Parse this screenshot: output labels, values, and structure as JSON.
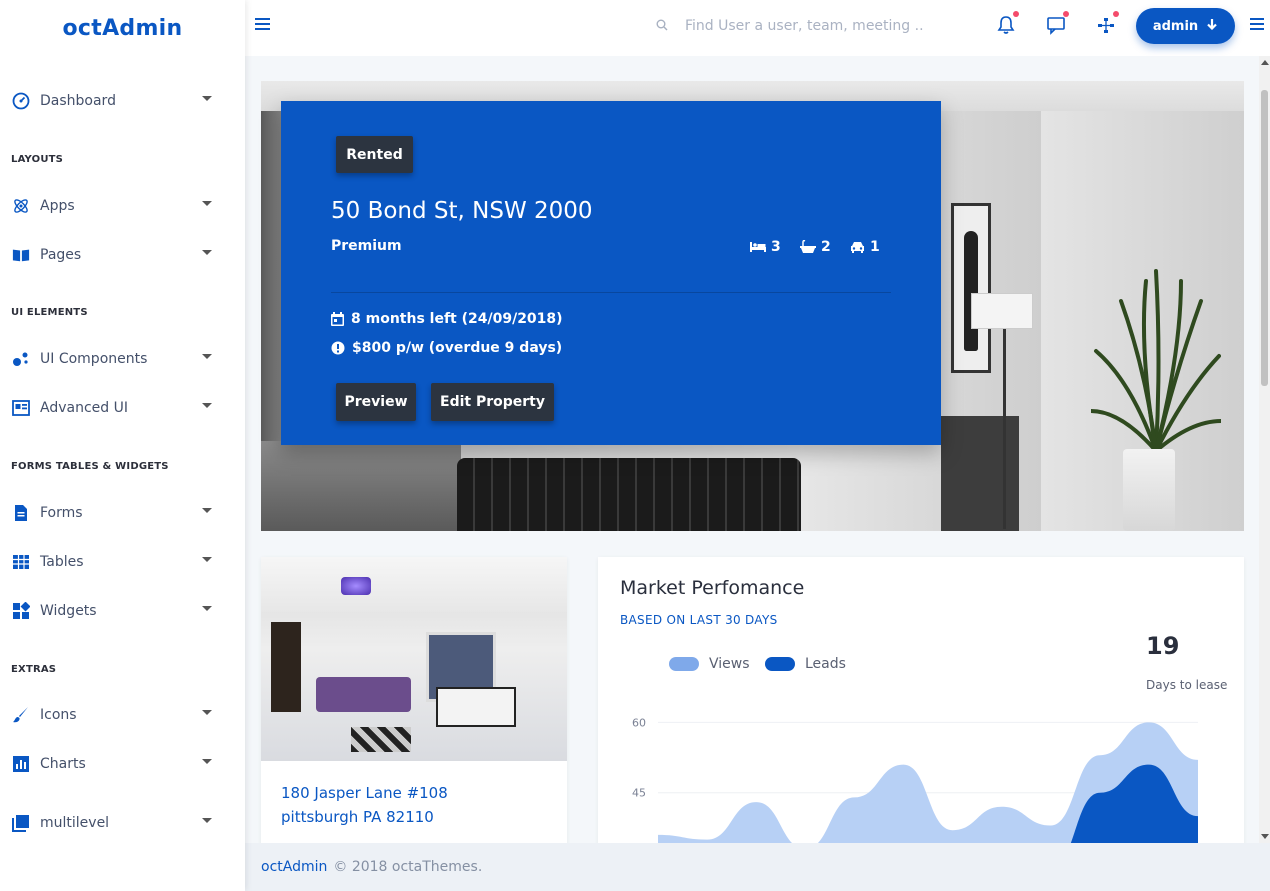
{
  "brand": "octAdmin",
  "sidebar": {
    "items": [
      {
        "label": "Dashboard",
        "icon": "dashboard-icon"
      },
      {
        "label": "Apps",
        "icon": "atom-icon"
      },
      {
        "label": "Pages",
        "icon": "book-icon"
      },
      {
        "label": "UI Components",
        "icon": "bubbles-icon"
      },
      {
        "label": "Advanced UI",
        "icon": "panel-icon"
      },
      {
        "label": "Forms",
        "icon": "document-icon"
      },
      {
        "label": "Tables",
        "icon": "table-icon"
      },
      {
        "label": "Widgets",
        "icon": "widgets-icon"
      },
      {
        "label": "Icons",
        "icon": "brush-icon"
      },
      {
        "label": "Charts",
        "icon": "bar-chart-icon"
      },
      {
        "label": "multilevel",
        "icon": "layers-icon"
      }
    ],
    "sections": [
      "LAYOUTS",
      "UI ELEMENTS",
      "FORMS TABLES & WIDGETS",
      "EXTRAS"
    ]
  },
  "topbar": {
    "search_placeholder": "Find User a user, team, meeting ..",
    "admin_label": "admin"
  },
  "hero": {
    "badge": "Rented",
    "address": "50 Bond St, NSW 2000",
    "tier": "Premium",
    "beds": "3",
    "baths": "2",
    "cars": "1",
    "lease_left": "8 months left (24/09/2018)",
    "rent": "$800 p/w (overdue 9 days)",
    "preview_label": "Preview",
    "edit_label": "Edit Property"
  },
  "property": {
    "address_line1": "180 Jasper Lane #108",
    "address_line2": "pittsburgh PA 82110"
  },
  "market": {
    "title": "Market Perfomance",
    "subtitle": "BASED ON LAST 30 DAYS",
    "stat_value": "19",
    "stat_label": "Days to lease"
  },
  "chart_data": {
    "type": "area",
    "series": [
      {
        "name": "Views",
        "color": "#b7d0f5",
        "points": [
          [
            0,
            36
          ],
          [
            1,
            35
          ],
          [
            2,
            43
          ],
          [
            3,
            33
          ],
          [
            4,
            44
          ],
          [
            5,
            51
          ],
          [
            6,
            37
          ],
          [
            7,
            42
          ],
          [
            8,
            38
          ],
          [
            9,
            53
          ],
          [
            10,
            60
          ],
          [
            11,
            52
          ]
        ]
      },
      {
        "name": "Leads",
        "color": "#0a57c3",
        "points": [
          [
            0,
            26
          ],
          [
            1,
            24
          ],
          [
            2,
            28
          ],
          [
            3,
            25
          ],
          [
            4,
            30
          ],
          [
            5,
            33
          ],
          [
            6,
            27
          ],
          [
            7,
            31
          ],
          [
            8,
            29
          ],
          [
            9,
            45
          ],
          [
            10,
            51
          ],
          [
            11,
            40
          ]
        ]
      }
    ],
    "y_ticks": [
      "60",
      "45"
    ],
    "ylim": [
      30,
      62
    ]
  },
  "footer": {
    "brand": "octAdmin",
    "copyright": "© 2018 octaThemes."
  },
  "colors": {
    "accent": "#0a57c3",
    "dark_button": "#2c3440",
    "notification_dot": "#f44b6b"
  }
}
